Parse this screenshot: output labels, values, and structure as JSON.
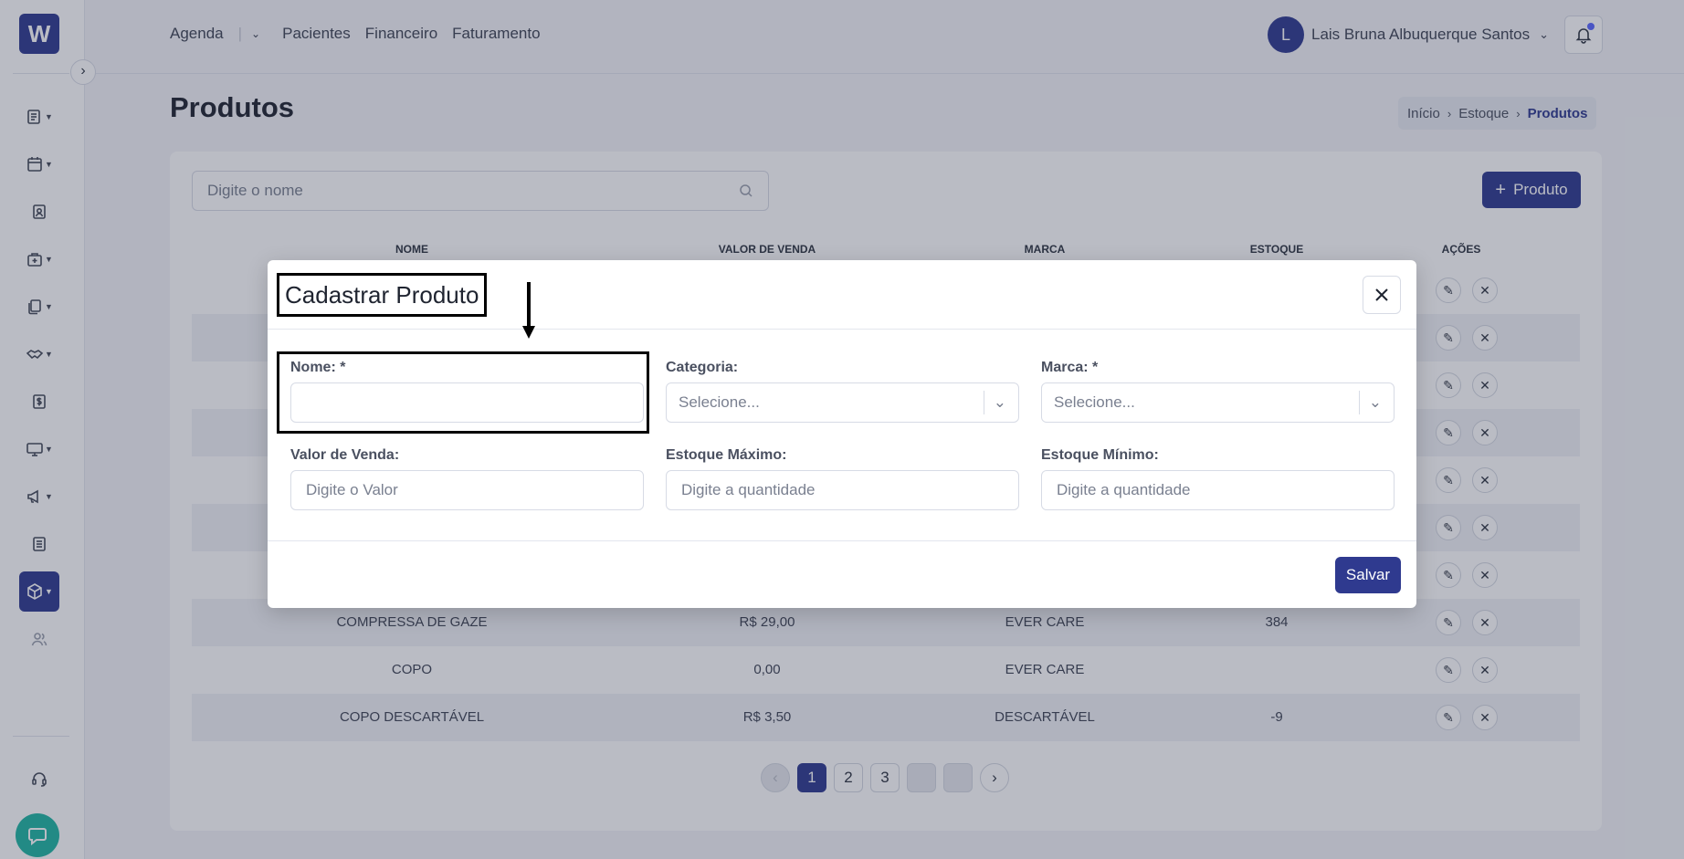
{
  "app": {
    "logo_text": "W"
  },
  "topnav": {
    "items": [
      "Agenda",
      "Pacientes",
      "Financeiro",
      "Faturamento"
    ]
  },
  "user": {
    "initial": "L",
    "name": "Lais Bruna Albuquerque Santos"
  },
  "page": {
    "title": "Produtos"
  },
  "breadcrumb": {
    "items": [
      "Início",
      "Estoque",
      "Produtos"
    ]
  },
  "search": {
    "placeholder": "Digite o nome"
  },
  "toolbar": {
    "add_label": "Produto"
  },
  "table": {
    "headers": [
      "NOME",
      "VALOR DE VENDA",
      "MARCA",
      "ESTOQUE",
      "AÇÕES"
    ],
    "visible_rows": [
      {
        "name": "COMPRESSA DE GAZE",
        "price": "R$ 29,00",
        "brand": "EVER CARE",
        "stock": "384"
      },
      {
        "name": "COPO",
        "price": "0,00",
        "brand": "EVER CARE",
        "stock": ""
      },
      {
        "name": "COPO DESCARTÁVEL",
        "price": "R$ 3,50",
        "brand": "DESCARTÁVEL",
        "stock": "-9"
      }
    ]
  },
  "pagination": {
    "pages": [
      "1",
      "2",
      "3"
    ],
    "current": "1"
  },
  "modal": {
    "title": "Cadastrar Produto",
    "fields": {
      "nome": {
        "label": "Nome: *",
        "value": "",
        "placeholder": ""
      },
      "categoria": {
        "label": "Categoria:",
        "placeholder": "Selecione..."
      },
      "marca": {
        "label": "Marca: *",
        "placeholder": "Selecione..."
      },
      "valor_venda": {
        "label": "Valor de Venda:",
        "placeholder": "Digite o Valor"
      },
      "estoque_max": {
        "label": "Estoque Máximo:",
        "placeholder": "Digite a quantidade"
      },
      "estoque_min": {
        "label": "Estoque Mínimo:",
        "placeholder": "Digite a quantidade"
      }
    },
    "save_label": "Salvar"
  },
  "colors": {
    "brand": "#2f3a8f",
    "chat": "#1fb5a3",
    "annotation": "#000000"
  },
  "icons": {
    "sidebar": [
      "list-icon",
      "calendar-icon",
      "patient-card-icon",
      "medical-bag-icon",
      "documents-icon",
      "handshake-icon",
      "dollar-icon",
      "monitor-icon",
      "megaphone-icon",
      "newspaper-icon",
      "box-icon",
      "users-icon",
      "headset-icon"
    ]
  }
}
